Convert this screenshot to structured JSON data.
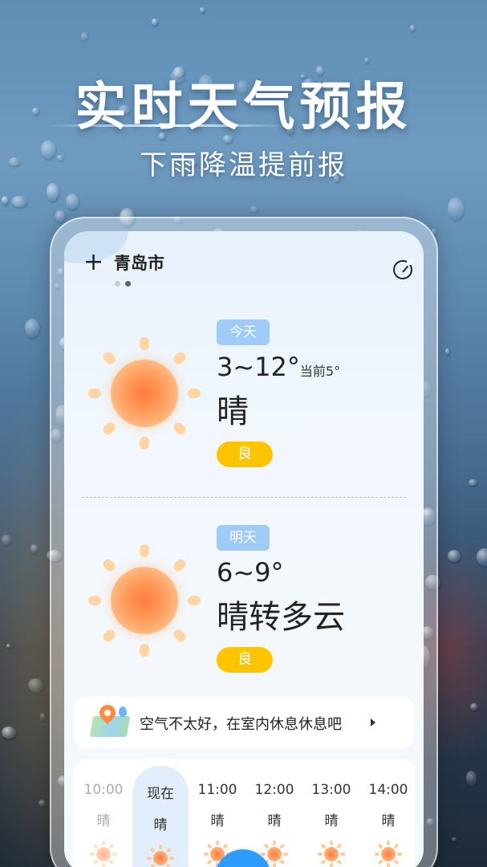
{
  "hero": {
    "title": "实时天气预报",
    "subtitle": "下雨降温提前报"
  },
  "header": {
    "add_icon": "plus-icon",
    "city": "青岛市",
    "page_dots": 2,
    "active_dot": 2,
    "refresh_icon": "refresh-icon"
  },
  "days": [
    {
      "tag": "今天",
      "temp_range": "3~12°",
      "current": "当前5°",
      "condition": "晴",
      "aqi": "良",
      "icon": "sun-icon"
    },
    {
      "tag": "明天",
      "temp_range": "6~9°",
      "current": "",
      "condition": "晴转多云",
      "aqi": "良",
      "icon": "sun-icon"
    }
  ],
  "tip": {
    "icon": "map-pin-icon",
    "text": "空气不太好，在室内休息休息吧"
  },
  "hourly": [
    {
      "time": "10:00",
      "condition": "晴",
      "state": "past"
    },
    {
      "time": "现在",
      "condition": "晴",
      "state": "current"
    },
    {
      "time": "11:00",
      "condition": "晴",
      "state": "future"
    },
    {
      "time": "12:00",
      "condition": "晴",
      "state": "future"
    },
    {
      "time": "13:00",
      "condition": "晴",
      "state": "future"
    },
    {
      "time": "14:00",
      "condition": "晴",
      "state": "future"
    }
  ],
  "colors": {
    "tag_blue": "#9ecbf7",
    "aqi_yellow": "#ffc400",
    "fab_blue": "#2e9bff",
    "sun_orange": "#ff7b3e"
  }
}
